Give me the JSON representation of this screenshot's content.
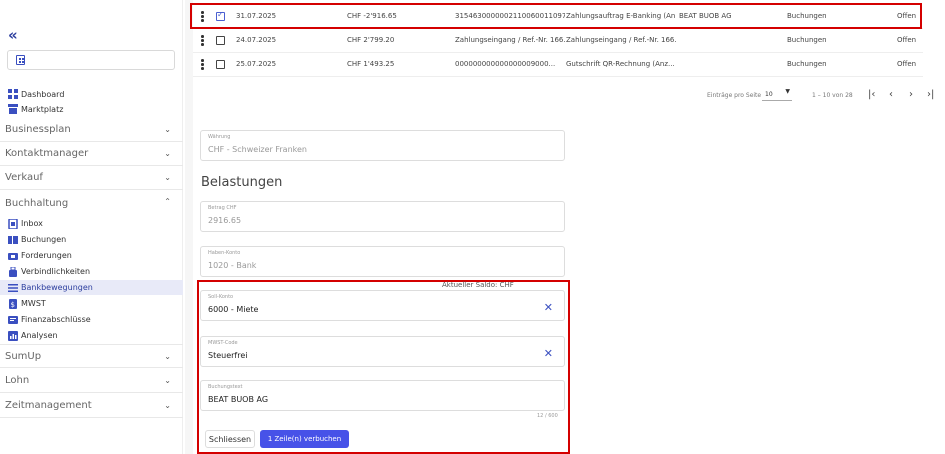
{
  "sidebar": {
    "collapse_icon": "chevrons-left-icon",
    "top_items": [
      {
        "label": "Dashboard",
        "icon": "dashboard-icon"
      },
      {
        "label": "Marktplatz",
        "icon": "store-icon"
      }
    ],
    "sections": [
      {
        "label": "Businessplan",
        "open": false
      },
      {
        "label": "Kontaktmanager",
        "open": false
      },
      {
        "label": "Verkauf",
        "open": false
      },
      {
        "label": "Buchhaltung",
        "open": true
      },
      {
        "label": "SumUp",
        "open": false
      },
      {
        "label": "Lohn",
        "open": false
      },
      {
        "label": "Zeitmanagement",
        "open": false
      }
    ],
    "buchhaltung_items": [
      {
        "label": "Inbox",
        "icon": "inbox-icon"
      },
      {
        "label": "Buchungen",
        "icon": "book-icon"
      },
      {
        "label": "Forderungen",
        "icon": "receivable-icon"
      },
      {
        "label": "Verbindlichkeiten",
        "icon": "bag-icon"
      },
      {
        "label": "Bankbewegungen",
        "icon": "list-icon",
        "active": true
      },
      {
        "label": "MWST",
        "icon": "tax-doc-icon"
      },
      {
        "label": "Finanzabschlüsse",
        "icon": "report-icon"
      },
      {
        "label": "Analysen",
        "icon": "chart-icon"
      }
    ]
  },
  "table": {
    "rows": [
      {
        "selected": true,
        "date": "31.07.2025",
        "amount": "CHF -2'916.65",
        "reference": "3154630000002110060011097...",
        "text": "Zahlungsauftrag E-Banking (An...",
        "partner": "BEAT BUOB AG",
        "type": "Buchungen",
        "status": "Offen"
      },
      {
        "selected": false,
        "date": "24.07.2025",
        "amount": "CHF 2'799.20",
        "reference": "Zahlungseingang / Ref.-Nr. 166...",
        "text": "Zahlungseingang / Ref.-Nr. 166...",
        "partner": "",
        "type": "Buchungen",
        "status": "Offen"
      },
      {
        "selected": false,
        "date": "25.07.2025",
        "amount": "CHF 1'493.25",
        "reference": "000000000000000009000...",
        "text": "Gutschrift QR-Rechnung (Anz...",
        "partner": "",
        "type": "Buchungen",
        "status": "Offen"
      }
    ],
    "pager": {
      "per_page_label": "Einträge pro Seite",
      "per_page_value": "10",
      "range_text": "1 – 10 von 28"
    }
  },
  "form": {
    "currency": {
      "label": "Währung",
      "value": "CHF - Schweizer Franken"
    },
    "heading": "Belastungen",
    "amount": {
      "label": "Betrag CHF",
      "value": "2916.65"
    },
    "haben": {
      "label": "Haben-Konto",
      "value": "1020 - Bank"
    },
    "saldo": "Aktueller Saldo: CHF",
    "soll": {
      "label": "Soll-Konto",
      "value": "6000 - Miete"
    },
    "mwst": {
      "label": "MWST-Code",
      "value": "Steuerfrei"
    },
    "buchungstext": {
      "label": "Buchungstext",
      "value": "BEAT BUOB AG"
    },
    "counter": "12 / 600",
    "close_label": "Schliessen",
    "book_label": "1 Zeile(n) verbuchen"
  },
  "colors": {
    "accent": "#4752e8",
    "highlight": "#d40000",
    "active_bg": "#e8eaf8"
  }
}
